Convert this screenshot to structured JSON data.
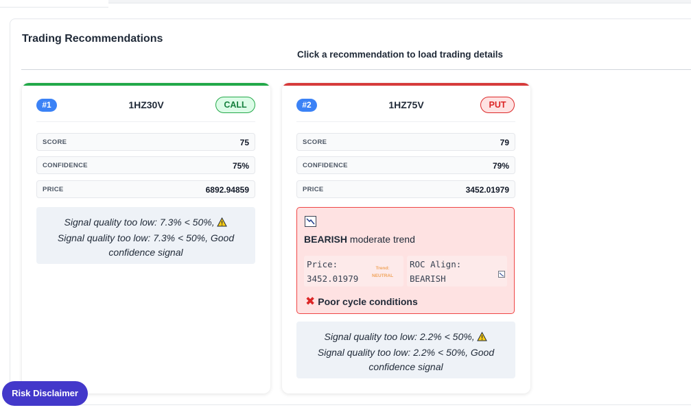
{
  "panel": {
    "title": "Trading Recommendations",
    "hint": "Click a recommendation to load trading details"
  },
  "cards": [
    {
      "rank": "#1",
      "symbol": "1HZ30V",
      "signal": "CALL",
      "metrics": [
        {
          "label": "SCORE",
          "value": "75"
        },
        {
          "label": "CONFIDENCE",
          "value": "75%"
        },
        {
          "label": "PRICE",
          "value": "6892.94859"
        }
      ],
      "quality": {
        "line1": "Signal quality too low: 7.3% < 50%,",
        "line2": "Signal quality too low: 7.3% < 50%, Good",
        "line3": "confidence signal"
      }
    },
    {
      "rank": "#2",
      "symbol": "1HZ75V",
      "signal": "PUT",
      "metrics": [
        {
          "label": "SCORE",
          "value": "79"
        },
        {
          "label": "CONFIDENCE",
          "value": "79%"
        },
        {
          "label": "PRICE",
          "value": "3452.01979"
        }
      ],
      "trend": {
        "direction": "BEARISH",
        "strength": "moderate trend",
        "price_label": "Price:",
        "price_value": "3452.01979",
        "trend_tag_1": "Trend:",
        "trend_tag_2": "NEUTRAL",
        "roc_label": "ROC Align:",
        "roc_value": "BEARISH",
        "cycle": "Poor cycle conditions",
        "icons": [
          "chart-down-icon",
          "chart-down-icon",
          "cross-mark-icon"
        ]
      },
      "quality": {
        "line1": "Signal quality too low: 2.2% < 50%,",
        "line2": "Signal quality too low: 2.2% < 50%, Good",
        "line3": "confidence signal"
      }
    }
  ],
  "risk_button": "Risk Disclaimer",
  "colors": {
    "call_accent": "#22a848",
    "put_accent": "#d63a3a",
    "rank_badge": "#3b82f6",
    "risk_button": "#4338ca"
  }
}
